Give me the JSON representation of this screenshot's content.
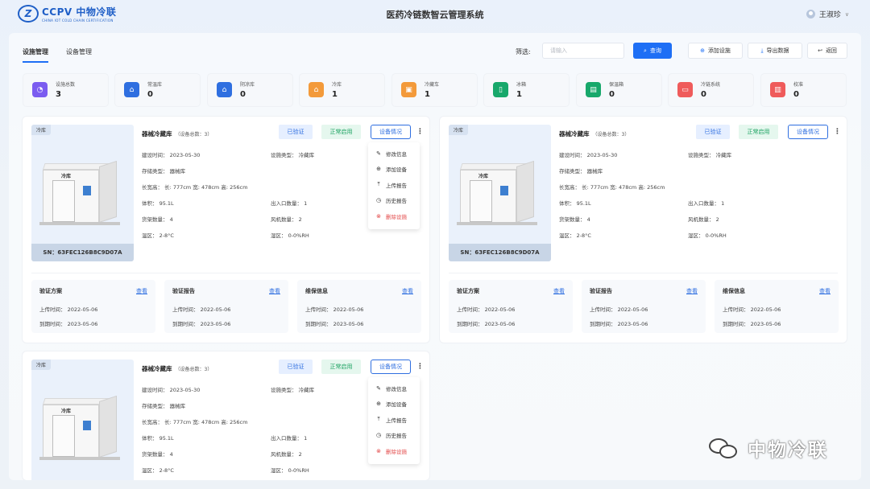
{
  "header": {
    "logo_mark": "Z",
    "logo_main": "CCPV 中物冷联",
    "logo_sub": "CHINA IOT COLD CHAIN CERTIFICATION",
    "title": "医药冷链数智云管理系统",
    "user_name": "王淑珍",
    "user_caret": "∨"
  },
  "tabs": [
    {
      "label": "设施管理",
      "active": true
    },
    {
      "label": "设备管理",
      "active": false
    }
  ],
  "toolbar": {
    "filter_label": "筛选:",
    "search_placeholder": "请输入",
    "query_label": "查询",
    "add_label": "添加设施",
    "export_label": "导出数据",
    "back_label": "返回"
  },
  "stats": [
    {
      "label": "设施总数",
      "value": "3",
      "icon": "pie-chart-icon",
      "color": "#7b5cf0"
    },
    {
      "label": "常温库",
      "value": "0",
      "icon": "warehouse-icon",
      "color": "#2f6fe0"
    },
    {
      "label": "阴凉库",
      "value": "0",
      "icon": "warehouse-icon",
      "color": "#2f6fe0"
    },
    {
      "label": "冷库",
      "value": "1",
      "icon": "house-icon",
      "color": "#f39a3a"
    },
    {
      "label": "冷藏车",
      "value": "1",
      "icon": "truck-icon",
      "color": "#f39a3a"
    },
    {
      "label": "冰箱",
      "value": "1",
      "icon": "fridge-icon",
      "color": "#18a86b"
    },
    {
      "label": "保温箱",
      "value": "0",
      "icon": "box-icon",
      "color": "#18a86b"
    },
    {
      "label": "冷链系统",
      "value": "0",
      "icon": "monitor-icon",
      "color": "#ef5b5b"
    },
    {
      "label": "校准",
      "value": "0",
      "icon": "calibrate-icon",
      "color": "#ef5b5b"
    }
  ],
  "cards": [
    {
      "tag": "冷库",
      "sn": "SN：63FEC126B8C9D07A",
      "room_label": "冷库",
      "name": "器械冷藏库",
      "device_count": "（设备总数：3）",
      "verified": "已验证",
      "status": "正常启用",
      "status_btn": "设备情况",
      "more": "⋮",
      "build_time": "建设时间：  2023-05-30",
      "facility_type": "设施类型：  冷藏库",
      "storage_type": "存储类型：  器械库",
      "dimensions": "长宽高：  长: 777cm    宽: 478cm    高: 256cm",
      "volume": "体积：  95.1L",
      "doors": "出入口数量：  1",
      "shelves": "货架数量：  4",
      "fans": "风机数量：  2",
      "temp": "温区：  2-8°C",
      "humidity": "湿区：  0-0%RH",
      "menu": [
        "修改信息",
        "添加设备",
        "上传报告",
        "历史报告",
        "删除设施"
      ],
      "subs": [
        {
          "title": "验证方案",
          "view": "查看",
          "upload": "上传时间：  2022-05-06",
          "expire": "到期时间：  2023-05-06"
        },
        {
          "title": "验证报告",
          "view": "查看",
          "upload": "上传时间：  2022-05-06",
          "expire": "到期时间：  2023-05-06"
        },
        {
          "title": "维保信息",
          "view": "查看",
          "upload": "上传时间：  2022-05-06",
          "expire": "到期时间：  2023-05-06"
        }
      ]
    },
    {
      "tag": "冷库",
      "sn": "SN：63FEC126B8C9D07A",
      "room_label": "冷库",
      "name": "器械冷藏库",
      "device_count": "（设备总数：3）",
      "verified": "已验证",
      "status": "正常启用",
      "status_btn": "设备情况",
      "more": "⋮",
      "build_time": "建设时间：  2023-05-30",
      "facility_type": "设施类型：  冷藏库",
      "storage_type": "存储类型：  器械库",
      "dimensions": "长宽高：  长: 777cm    宽: 478cm    高: 256cm",
      "volume": "体积：  95.1L",
      "doors": "出入口数量：  1",
      "shelves": "货架数量：  4",
      "fans": "风机数量：  2",
      "temp": "温区：  2-8°C",
      "humidity": "湿区：  0-0%RH",
      "subs": [
        {
          "title": "验证方案",
          "view": "查看",
          "upload": "上传时间：  2022-05-06",
          "expire": "到期时间：  2023-05-06"
        },
        {
          "title": "验证报告",
          "view": "查看",
          "upload": "上传时间：  2022-05-06",
          "expire": "到期时间：  2023-05-06"
        },
        {
          "title": "维保信息",
          "view": "查看",
          "upload": "上传时间：  2022-05-06",
          "expire": "到期时间：  2023-05-06"
        }
      ]
    },
    {
      "tag": "冷库",
      "room_label": "冷库",
      "name": "器械冷藏库",
      "device_count": "（设备总数：3）",
      "verified": "已验证",
      "status": "正常启用",
      "status_btn": "设备情况",
      "more": "⋮",
      "build_time": "建设时间：  2023-05-30",
      "facility_type": "设施类型：  冷藏库",
      "storage_type": "存储类型：  器械库",
      "dimensions": "长宽高：  长: 777cm    宽: 478cm    高: 256cm",
      "volume": "体积：  95.1L",
      "doors": "出入口数量：  1",
      "shelves": "货架数量：  4",
      "fans": "风机数量：  2",
      "temp": "温区：  2-8°C",
      "humidity": "湿区：  0-0%RH",
      "menu": [
        "修改信息",
        "添加设备",
        "上传报告",
        "历史报告",
        "删除设施"
      ]
    }
  ],
  "watermark": "中物冷联",
  "colors": {
    "primary": "#1e6ff5",
    "success": "#1aa260",
    "danger": "#e34a4a"
  }
}
